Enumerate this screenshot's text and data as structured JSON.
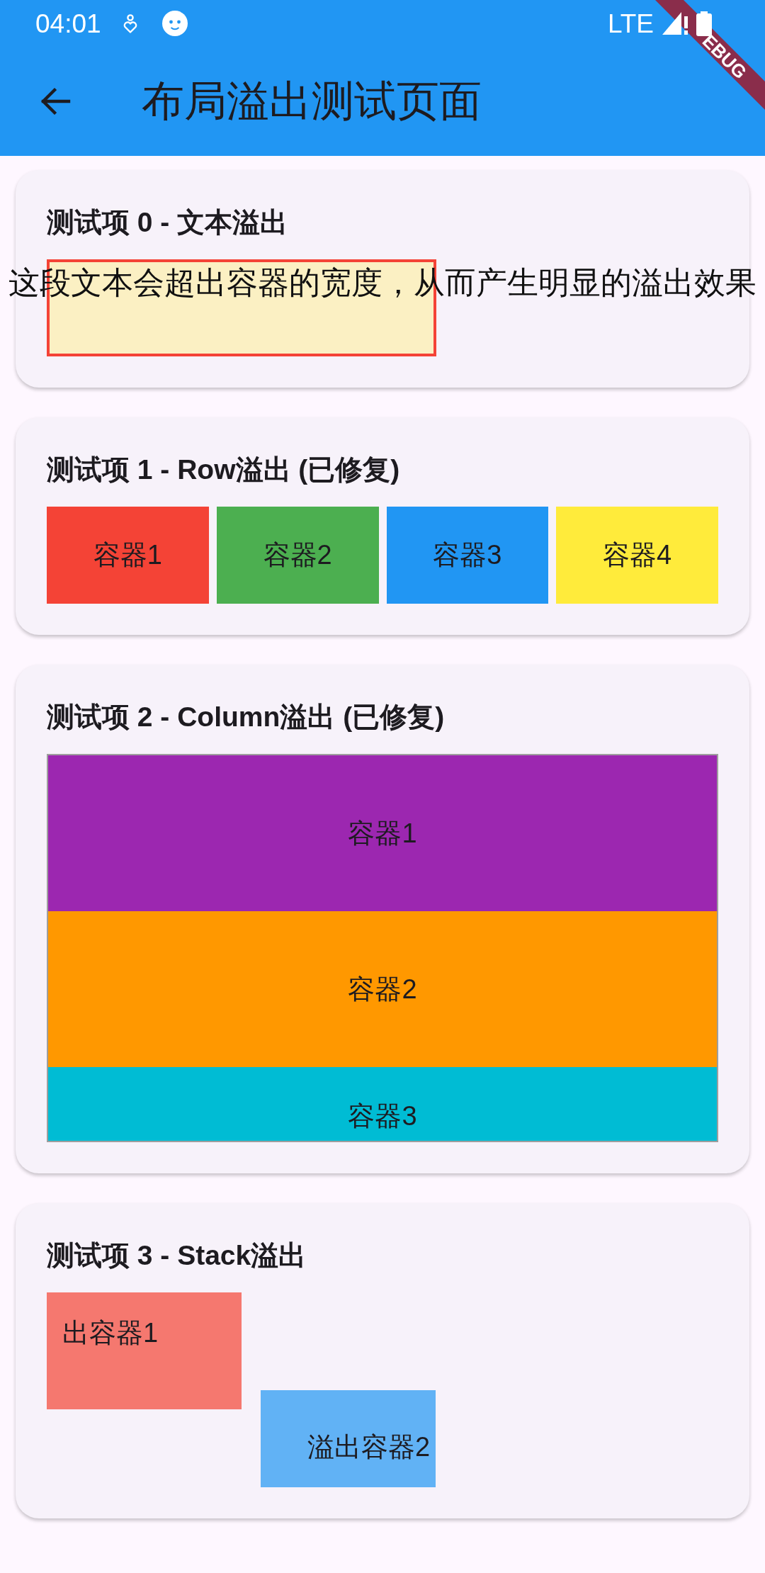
{
  "status_bar": {
    "time": "04:01",
    "network": "LTE"
  },
  "debug_banner": {
    "label": "EBUG"
  },
  "app_bar": {
    "title": "布局溢出测试页面"
  },
  "tests": [
    {
      "kind": "text_overflow",
      "title": "测试项 0 - 文本溢出",
      "text": "这段文本会超出容器的宽度，从而产生明显的溢出效果"
    },
    {
      "kind": "row",
      "title": "测试项 1 - Row溢出 (已修复)",
      "boxes": [
        {
          "label": "容器1",
          "color": "#f44336"
        },
        {
          "label": "容器2",
          "color": "#4caf50"
        },
        {
          "label": "容器3",
          "color": "#2196f3"
        },
        {
          "label": "容器4",
          "color": "#ffeb3b"
        }
      ]
    },
    {
      "kind": "column",
      "title": "测试项 2 - Column溢出 (已修复)",
      "boxes": [
        {
          "label": "容器1",
          "color": "#9c27b0"
        },
        {
          "label": "容器2",
          "color": "#ff9800"
        },
        {
          "label": "容器3",
          "color": "#00bcd4"
        }
      ]
    },
    {
      "kind": "stack",
      "title": "测试项 3 - Stack溢出",
      "boxes": [
        {
          "label": "出容器1",
          "color": "#f5786f"
        },
        {
          "label": "溢出容器2",
          "color": "#61b2f5"
        }
      ]
    }
  ]
}
